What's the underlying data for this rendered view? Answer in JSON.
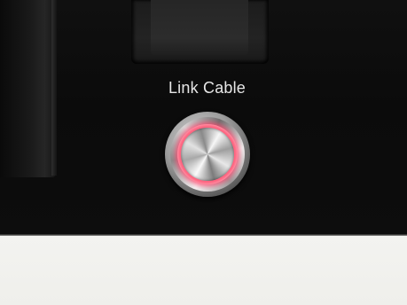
{
  "photo": {
    "panel_label": "Link Cable",
    "button_light_color": "#ff5f7c",
    "panel_color": "#0d0d0d",
    "surface_color": "#f1f1ee"
  }
}
